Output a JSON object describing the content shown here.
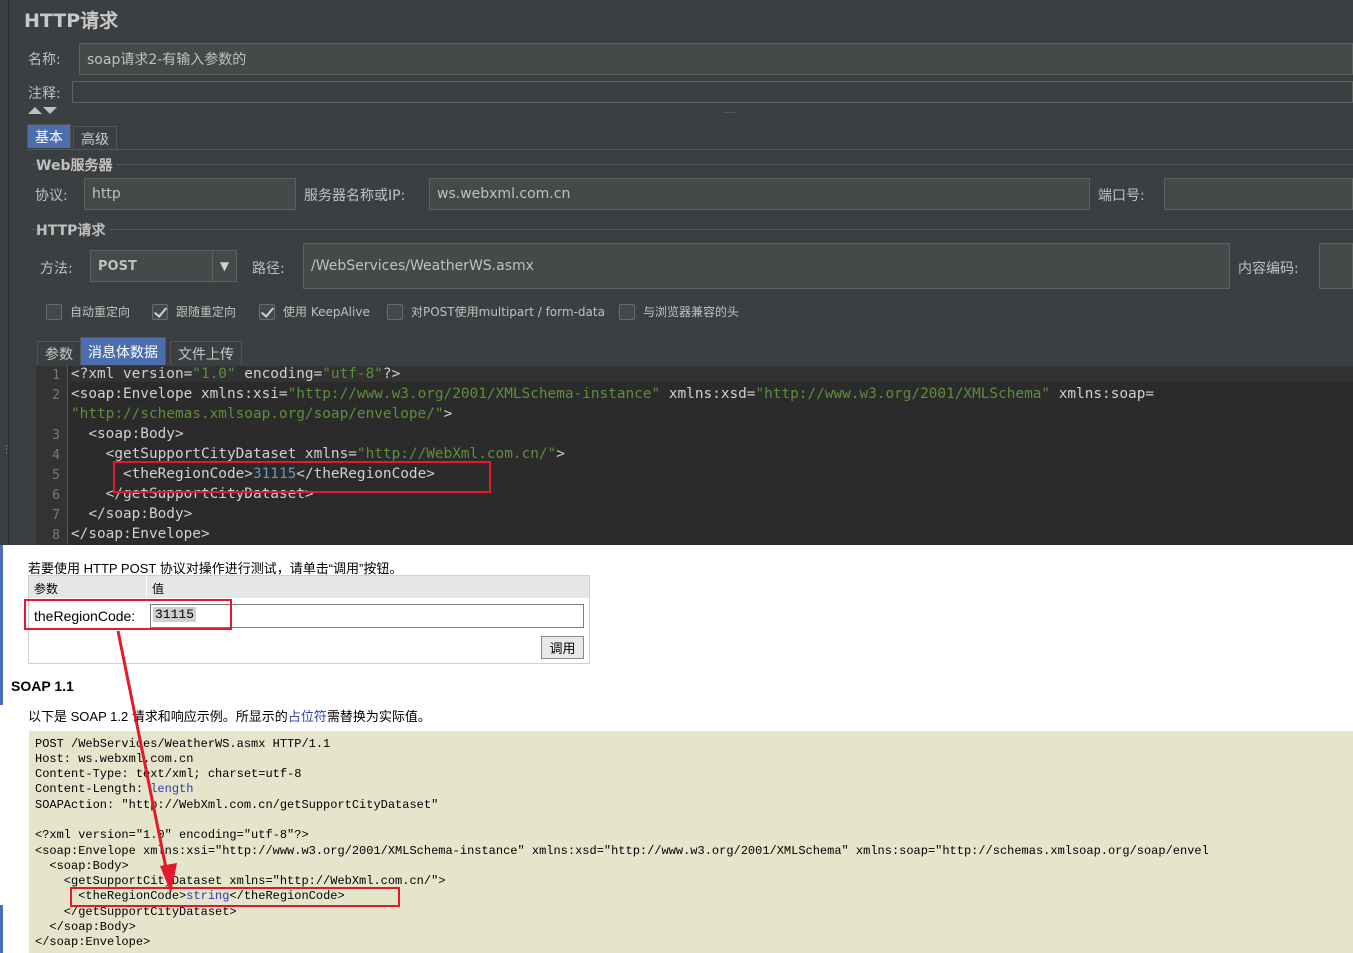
{
  "jmeter": {
    "title": "HTTP请求",
    "name_label": "名称:",
    "name_value": "soap请求2-有输入参数的",
    "comment_label": "注释:",
    "tabs": [
      "基本",
      "高级"
    ],
    "web_server": {
      "group_title": "Web服务器",
      "protocol_label": "协议:",
      "protocol_value": "http",
      "server_label": "服务器名称或IP:",
      "server_value": "ws.webxml.com.cn",
      "port_label": "端口号:"
    },
    "http_request": {
      "group_title": "HTTP请求",
      "method_label": "方法:",
      "method_value": "POST",
      "path_label": "路径:",
      "path_value": "/WebServices/WeatherWS.asmx",
      "encoding_label": "内容编码:"
    },
    "checkboxes": [
      {
        "label": "自动重定向",
        "checked": false
      },
      {
        "label": "跟随重定向",
        "checked": true
      },
      {
        "label": "使用 KeepAlive",
        "checked": true
      },
      {
        "label": "对POST使用multipart / form-data",
        "checked": false
      },
      {
        "label": "与浏览器兼容的头",
        "checked": false
      }
    ],
    "body_tabs": [
      "参数",
      "消息体数据",
      "文件上传"
    ],
    "editor_line_numbers": [
      "1",
      "2",
      "3",
      "4",
      "5",
      "6",
      "7",
      "8"
    ],
    "editor_lines": [
      {
        "t": "<?xml version=",
        "s": "\"1.0\"",
        "t2": " encoding=",
        "s2": "\"utf-8\"",
        "t3": "?>"
      },
      {
        "t": "<soap:Envelope xmlns:xsi=",
        "s": "\"http://www.w3.org/2001/XMLSchema-instance\"",
        "t2": " xmlns:xsd=",
        "s2": "\"http://www.w3.org/2001/XMLSchema\"",
        "t3": " xmlns:soap="
      },
      {
        "t": "",
        "s": "\"http://schemas.xmlsoap.org/soap/envelope/\"",
        "t2": ">",
        "s2": "",
        "t3": ""
      },
      {
        "t": "  <soap:Body>",
        "s": "",
        "t2": "",
        "s2": "",
        "t3": ""
      },
      {
        "t": "    <getSupportCityDataset xmlns=",
        "s": "\"http://WebXml.com.cn/\"",
        "t2": ">",
        "s2": "",
        "t3": ""
      },
      {
        "t": "      <theRegionCode>",
        "s": "",
        "t2": "31115",
        "s2": "",
        "t3": "</theRegionCode>"
      },
      {
        "t": "    </getSupportCityDataset>",
        "s": "",
        "t2": "",
        "s2": "",
        "t3": ""
      },
      {
        "t": "  </soap:Body>",
        "s": "",
        "t2": "",
        "s2": "",
        "t3": ""
      },
      {
        "t": "</soap:Envelope>",
        "s": "",
        "t2": "",
        "s2": "",
        "t3": ""
      }
    ]
  },
  "webpage": {
    "intro": "若要使用 HTTP POST 协议对操作进行测试，请单击“调用”按钮。",
    "table_header_param": "参数",
    "table_header_value": "值",
    "param_name": "theRegionCode:",
    "param_value": "31115",
    "invoke_button": "调用",
    "soap_heading": "SOAP 1.1",
    "soap_desc_pre": "以下是 SOAP 1.2 请求和响应示例。所显示的",
    "soap_desc_link": "占位符",
    "soap_desc_post": "需替换为实际值。",
    "sample_lines": [
      "POST /WebServices/WeatherWS.asmx HTTP/1.1",
      "Host: ws.webxml.com.cn",
      "Content-Type: text/xml; charset=utf-8",
      "Content-Length: ",
      "SOAPAction: \"http://WebXml.com.cn/getSupportCityDataset\"",
      "",
      "<?xml version=\"1.0\" encoding=\"utf-8\"?>",
      "<soap:Envelope xmlns:xsi=\"http://www.w3.org/2001/XMLSchema-instance\" xmlns:xsd=\"http://www.w3.org/2001/XMLSchema\" xmlns:soap=\"http://schemas.xmlsoap.org/soap/envel",
      "  <soap:Body>",
      "    <getSupportCityDataset xmlns=\"http://WebXml.com.cn/\">",
      "      <theRegionCode>",
      "    </getSupportCityDataset>",
      "  </soap:Body>",
      "</soap:Envelope>"
    ],
    "content_length_placeholder": "length",
    "region_placeholder": "string",
    "region_close": "</theRegionCode>"
  },
  "annotation": {
    "box_color": "#e5192a",
    "arrow_color": "#e5192a"
  }
}
